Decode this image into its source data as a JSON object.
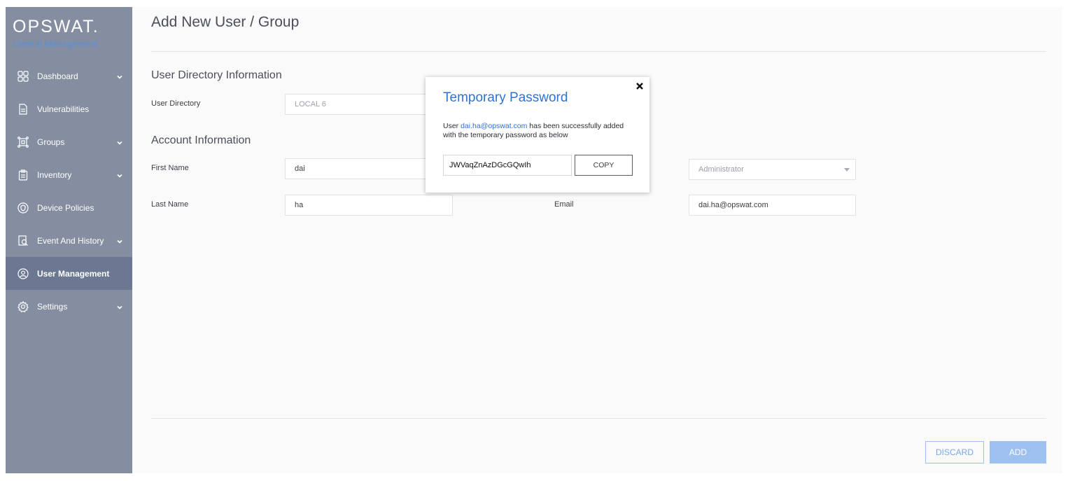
{
  "brand": {
    "logo": "OPSWAT.",
    "subtitle": "Central Management"
  },
  "sidebar": {
    "items": [
      {
        "label": "Dashboard",
        "icon": "dashboard-icon",
        "expandable": true
      },
      {
        "label": "Vulnerabilities",
        "icon": "document-icon",
        "expandable": false
      },
      {
        "label": "Groups",
        "icon": "groups-icon",
        "expandable": true
      },
      {
        "label": "Inventory",
        "icon": "clipboard-icon",
        "expandable": true
      },
      {
        "label": "Device Policies",
        "icon": "shield-icon",
        "expandable": false
      },
      {
        "label": "Event And History",
        "icon": "history-icon",
        "expandable": true
      },
      {
        "label": "User Management",
        "icon": "user-management-icon",
        "expandable": false,
        "active": true
      },
      {
        "label": "Settings",
        "icon": "gear-icon",
        "expandable": true
      }
    ]
  },
  "page": {
    "title": "Add New User / Group",
    "section_directory": "User Directory Information",
    "section_account": "Account Information",
    "fields": {
      "user_directory_label": "User Directory",
      "user_directory_value": "LOCAL 6",
      "first_name_label": "First Name",
      "first_name_value": "dai",
      "last_name_label": "Last Name",
      "last_name_value": "ha",
      "role_value": "Administrator",
      "email_label": "Email",
      "email_value": "dai.ha@opswat.com"
    },
    "buttons": {
      "discard": "DISCARD",
      "add": "ADD"
    }
  },
  "modal": {
    "title": "Temporary Password",
    "msg_prefix": "User ",
    "msg_email": "dai.ha@opswat.com",
    "msg_suffix": " has been successfully added with the temporary password as below",
    "password": "JWVaqZnAzDGcGQwIh",
    "copy_label": "COPY"
  },
  "colors": {
    "sidebar": "#858ea0",
    "sidebar_active": "#6c7891",
    "accent": "#2d73d1",
    "button_light": "#9ec1f1"
  }
}
